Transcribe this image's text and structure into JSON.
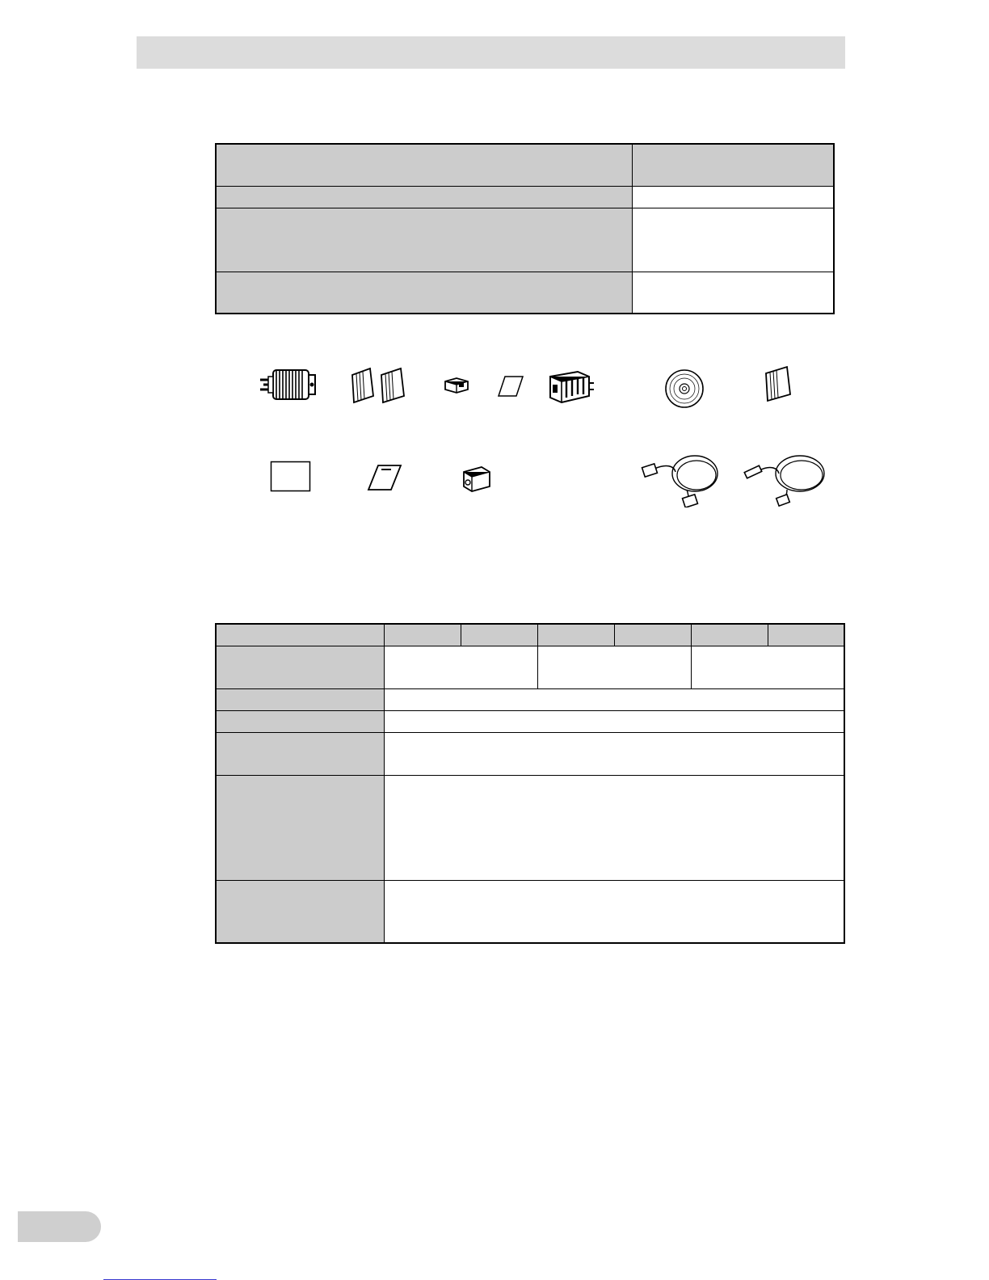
{
  "header": {
    "section_title": ""
  },
  "contents_table": {
    "rows": [
      {
        "item": "",
        "qty": ""
      },
      {
        "item": "",
        "qty": ""
      },
      {
        "item": "",
        "qty": ""
      },
      {
        "item": "",
        "qty": ""
      }
    ]
  },
  "accessories": {
    "row1": [
      "plug-adapter-icon",
      "manual-booklets-icon",
      "ferrite-core-icon",
      "card-icon",
      "terminal-block-icon",
      "cd-rom-icon",
      "booklet-icon"
    ],
    "row2": [
      "label-sheet-icon",
      "warranty-card-icon",
      "core-block-icon",
      "serial-cable-icon",
      "usb-cable-icon"
    ]
  },
  "spec_table": {
    "header": [
      "",
      "",
      "",
      "",
      "",
      "",
      ""
    ],
    "rows": [
      {
        "label": "",
        "values": [
          "",
          "",
          ""
        ]
      },
      {
        "label": "",
        "value": ""
      },
      {
        "label": "",
        "value": ""
      },
      {
        "label": "",
        "value": ""
      },
      {
        "label": "",
        "value": ""
      },
      {
        "label": "",
        "value": ""
      }
    ]
  },
  "footer": {
    "page_number": ""
  }
}
